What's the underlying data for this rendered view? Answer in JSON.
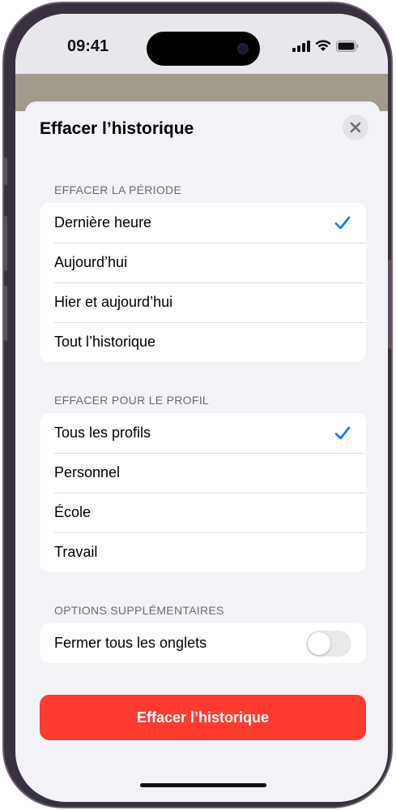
{
  "status_bar": {
    "time": "09:41"
  },
  "sheet": {
    "title": "Effacer l’historique",
    "sections": [
      {
        "header": "EFFACER LA PÉRIODE",
        "items": [
          {
            "label": "Dernière heure",
            "selected": true
          },
          {
            "label": "Aujourd’hui",
            "selected": false
          },
          {
            "label": "Hier et aujourd’hui",
            "selected": false
          },
          {
            "label": "Tout l’historique",
            "selected": false
          }
        ]
      },
      {
        "header": "EFFACER POUR LE PROFIL",
        "items": [
          {
            "label": "Tous les profils",
            "selected": true
          },
          {
            "label": "Personnel",
            "selected": false
          },
          {
            "label": "École",
            "selected": false
          },
          {
            "label": "Travail",
            "selected": false
          }
        ]
      },
      {
        "header": "OPTIONS SUPPLÉMENTAIRES",
        "items": [
          {
            "label": "Fermer tous les onglets",
            "toggle": false
          }
        ]
      }
    ],
    "primary_button": "Effacer l’historique"
  },
  "colors": {
    "accent": "#007aff",
    "destructive": "#ff3b30",
    "background": "#f2f2f7"
  }
}
